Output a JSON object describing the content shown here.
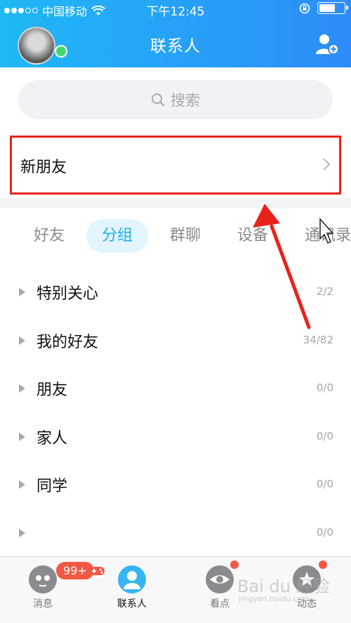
{
  "status_bar": {
    "carrier": "中国移动",
    "time": "下午12:45"
  },
  "header": {
    "title": "联系人"
  },
  "search": {
    "placeholder": "搜索"
  },
  "new_friends": {
    "label": "新朋友"
  },
  "tabs": [
    {
      "label": "好友"
    },
    {
      "label": "分组"
    },
    {
      "label": "群聊"
    },
    {
      "label": "设备"
    },
    {
      "label": "通讯录"
    }
  ],
  "active_tab": "分组",
  "groups": [
    {
      "name": "特别关心",
      "count": "2/2"
    },
    {
      "name": "我的好友",
      "count": "34/82"
    },
    {
      "name": "朋友",
      "count": "0/0"
    },
    {
      "name": "家人",
      "count": "0/0"
    },
    {
      "name": "同学",
      "count": "0/0"
    },
    {
      "name": "",
      "count": "0/0"
    }
  ],
  "bottom_nav": [
    {
      "label": "消息",
      "badge": "99+"
    },
    {
      "label": "联系人"
    },
    {
      "label": "看点"
    },
    {
      "label": "动态"
    }
  ],
  "colors": {
    "accent": "#16aff0",
    "highlight": "#e8221a",
    "badge": "#f35845"
  },
  "watermark": {
    "text": "Bai du 经验",
    "sub": "jingyan.baidu.com"
  }
}
